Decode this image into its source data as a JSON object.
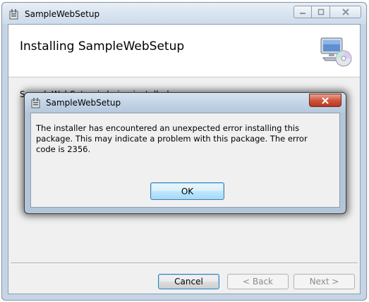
{
  "window": {
    "title": "SampleWebSetup",
    "banner_title": "Installing SampleWebSetup",
    "status_text": "SampleWebSetup is being installed.",
    "icons": {
      "app": "setup-package-icon",
      "banner": "computer-cd-icon",
      "minimize": "minimize-icon",
      "maximize": "maximize-icon",
      "close": "close-icon"
    },
    "buttons": {
      "cancel": "Cancel",
      "back": "< Back",
      "next": "Next >"
    }
  },
  "dialog": {
    "title": "SampleWebSetup",
    "message": "The installer has encountered an unexpected error installing this package. This may indicate a problem with this package. The error code is 2356.",
    "ok_label": "OK",
    "icons": {
      "app": "setup-package-icon",
      "close": "close-icon"
    }
  },
  "colors": {
    "dialog_close": "#c8452c",
    "focus_border": "#3c7fb1",
    "disabled_text": "#8c8c8c"
  }
}
